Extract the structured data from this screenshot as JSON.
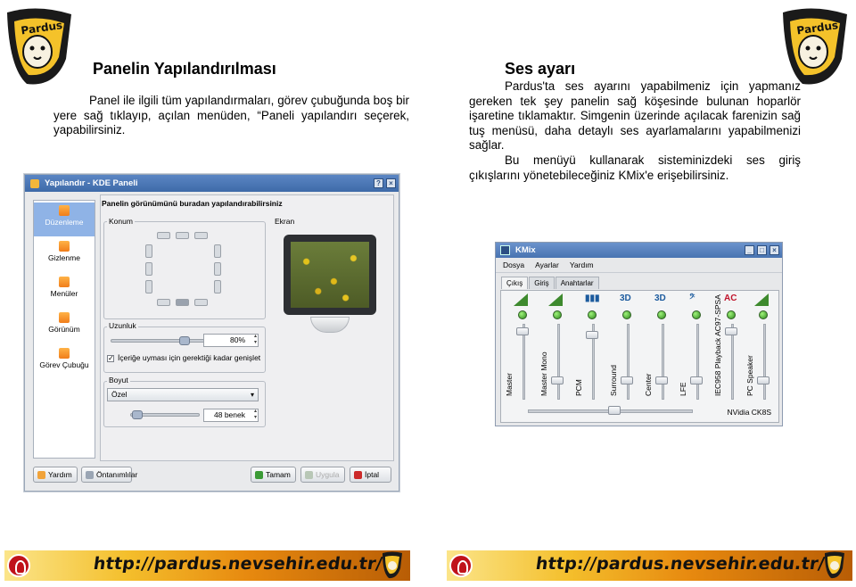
{
  "left": {
    "title": "Panelin Yapılandırılması",
    "paragraph": "Panel ile ilgili tüm yapılandırmaları, görev çubuğunda boş bir yere sağ tıklayıp, açılan menüden, “Paneli yapılandırı seçerek, yapabilirsiniz."
  },
  "right": {
    "title": "Ses ayarı",
    "paragraph1": "Pardus'ta ses ayarını yapabilmeniz için yapmanız gereken tek şey panelin sağ köşesinde bulunan hoparlör işaretine tıklamaktır. Simgenin üzerinde açılacak farenizin sağ tuş menüsü, daha detaylı ses ayarlamalarını yapabilmenizi sağlar.",
    "paragraph2": "Bu menüyü kullanarak sisteminizdeki ses giriş çıkışlarını yönetebileceğiniz KMix'e erişebilirsiniz."
  },
  "logo": {
    "text": "Pardus"
  },
  "kde_dialog": {
    "title": "Yapılandır - KDE Paneli",
    "heading": "Panelin görünümünü buradan yapılandırabilirsiniz",
    "sidebar": [
      "Düzenleme",
      "Gizlenme",
      "Menüler",
      "Görünüm",
      "Görev Çubuğu"
    ],
    "groups": {
      "konum": "Konum",
      "ekran": "Ekran",
      "uzunluk": "Uzunluk",
      "boyut": "Boyut"
    },
    "uzunluk_value": "80%",
    "uzunluk_level": 0.8,
    "checkbox_label": "İçeriğe uyması için gerektiği kadar genişlet",
    "boyut_select": "Özel",
    "boyut_value": "48 benek",
    "buttons": {
      "help": "Yardım",
      "defaults": "Öntanımlılar",
      "ok": "Tamam",
      "apply": "Uygula",
      "cancel": "İptal"
    }
  },
  "kmix": {
    "title": "KMix",
    "menu": [
      "Dosya",
      "Ayarlar",
      "Yardım"
    ],
    "tabs": [
      "Çıkış",
      "Giriş",
      "Anahtarlar"
    ],
    "channels": [
      "Master",
      "Master Mono",
      "PCM",
      "Surround",
      "Center",
      "LFE",
      "IEC958 Playback AC97-SPSA",
      "PC Speaker"
    ],
    "device": "NVidia CK8S"
  },
  "footer": {
    "url": "http://pardus.nevsehir.edu.tr/"
  },
  "colors": {
    "banner_start": "#fbe58a",
    "banner_end": "#b85d05",
    "kde_title": "#3e6aa8",
    "kmix_title": "#4873b1"
  }
}
